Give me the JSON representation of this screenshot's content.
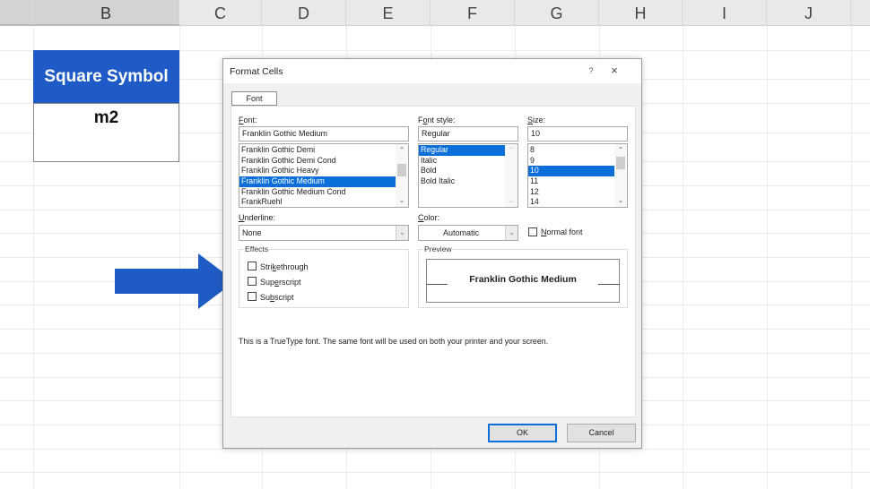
{
  "sheet": {
    "columns": [
      {
        "label": "B",
        "selected": true
      },
      {
        "label": "C",
        "selected": false
      },
      {
        "label": "D",
        "selected": false
      },
      {
        "label": "E",
        "selected": false
      },
      {
        "label": "F",
        "selected": false
      },
      {
        "label": "G",
        "selected": false
      },
      {
        "label": "H",
        "selected": false
      },
      {
        "label": "I",
        "selected": false
      },
      {
        "label": "J",
        "selected": false
      }
    ],
    "header_cell": "Square Symbol",
    "value_cell": "m2",
    "header_cell_color": "#1e5bc6"
  },
  "annotation": {
    "arrow_color": "#1f5bc4",
    "arrow_points_to": "superscript-checkbox"
  },
  "dialog": {
    "title": "Format Cells",
    "help_icon": "?",
    "close_icon": "×",
    "tab_label": "Font",
    "font": {
      "label_prefix": "F",
      "label_rest": "ont:",
      "value": "Franklin Gothic Medium",
      "items": [
        "Franklin Gothic Demi",
        "Franklin Gothic Demi Cond",
        "Franklin Gothic Heavy",
        "Franklin Gothic Medium",
        "Franklin Gothic Medium Cond",
        "FrankRuehl"
      ],
      "selected_index": 3
    },
    "font_style": {
      "label_a": "F",
      "label_u": "o",
      "label_b": "nt style:",
      "value": "Regular",
      "items": [
        "Regular",
        "Italic",
        "Bold",
        "Bold Italic"
      ],
      "selected_index": 0
    },
    "size": {
      "label_u": "S",
      "label_rest": "ize:",
      "value": "10",
      "items": [
        "8",
        "9",
        "10",
        "11",
        "12",
        "14"
      ],
      "selected_index": 2
    },
    "underline": {
      "label_u": "U",
      "label_rest": "nderline:",
      "value": "None"
    },
    "color": {
      "label_u": "C",
      "label_rest": "olor:",
      "value": "Automatic"
    },
    "normal_font": {
      "label_u": "N",
      "label_rest": "ormal font",
      "checked": false
    },
    "effects": {
      "title": "Effects",
      "strikethrough": {
        "a": "Stri",
        "u": "k",
        "b": "ethrough",
        "checked": false
      },
      "superscript": {
        "a": "Sup",
        "u": "e",
        "b": "rscript",
        "checked": false
      },
      "subscript": {
        "a": "Su",
        "u": "b",
        "b": "script",
        "checked": false
      }
    },
    "preview": {
      "title": "Preview",
      "sample": "Franklin Gothic Medium"
    },
    "info": "This is a TrueType font.  The same font will be used on both your printer and your screen.",
    "ok_label": "OK",
    "cancel_label": "Cancel",
    "accent_color": "#0a6fd8"
  }
}
